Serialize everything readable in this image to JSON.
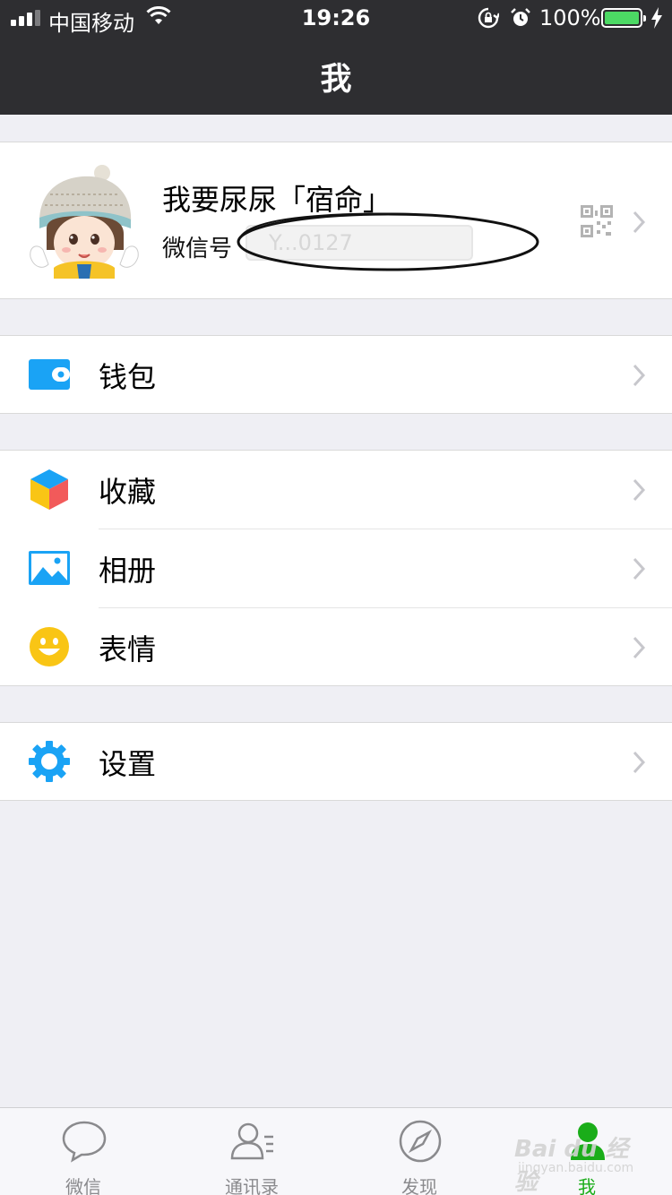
{
  "status_bar": {
    "carrier": "中国移动",
    "time": "19:26",
    "battery": "100%",
    "battery_color": "#4cd964"
  },
  "nav": {
    "title": "我"
  },
  "profile": {
    "nickname": "我要尿尿「宿命」",
    "wechat_id_label": "微信号",
    "wechat_id_value": "Y...0127",
    "qr_icon": "qr-code-icon"
  },
  "menu": {
    "wallet": {
      "label": "钱包",
      "icon": "wallet-icon",
      "color": "#1aa3f5"
    },
    "favorites": {
      "label": "收藏",
      "icon": "favorites-cube-icon"
    },
    "album": {
      "label": "相册",
      "icon": "album-icon",
      "color": "#1aa3f5"
    },
    "stickers": {
      "label": "表情",
      "icon": "smiley-icon",
      "color": "#f9c515"
    },
    "settings": {
      "label": "设置",
      "icon": "gear-icon",
      "color": "#1aa3f5"
    }
  },
  "tabbar": {
    "tabs": [
      {
        "label": "微信",
        "icon": "chat-bubble-icon"
      },
      {
        "label": "通讯录",
        "icon": "contacts-icon"
      },
      {
        "label": "发现",
        "icon": "compass-icon"
      },
      {
        "label": "我",
        "icon": "me-icon",
        "active": true
      }
    ],
    "active_color": "#1aad19"
  },
  "watermark": {
    "text": "Bai du 经验",
    "sub": "jingyan.baidu.com"
  }
}
